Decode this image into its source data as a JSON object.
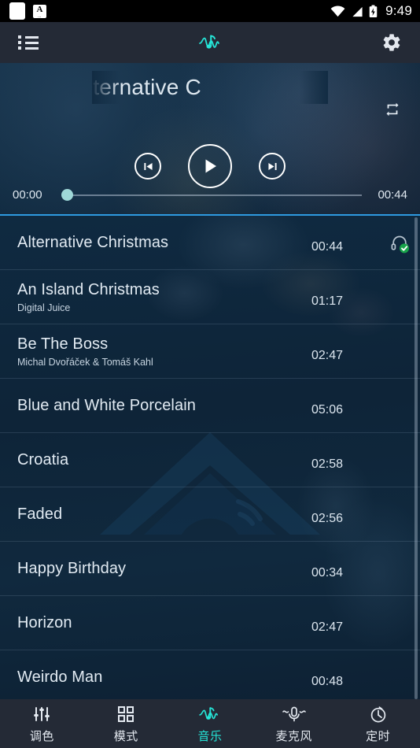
{
  "statusbar": {
    "left_icons": [
      "app-square-icon",
      "letter-a-badge-icon"
    ],
    "badge_letter": "A",
    "badge_sub": "...",
    "right_icons": [
      "wifi-icon",
      "cellular-signal-icon",
      "battery-charging-icon"
    ],
    "time": "9:49"
  },
  "toolbar": {
    "menu_icon": "list-menu-icon",
    "brand_icon": "music-wave-icon",
    "settings_icon": "gear-icon"
  },
  "player": {
    "track_title": "Alternative C",
    "repeat_icon": "repeat-icon",
    "prev_icon": "skip-previous-icon",
    "play_icon": "play-icon",
    "next_icon": "skip-next-icon",
    "elapsed": "00:00",
    "duration": "00:44",
    "progress_percent": 0,
    "accent_color": "#2e9ae0",
    "seek_dot_color": "#9fd8d8"
  },
  "list": {
    "now_playing_icon": "headphone-check-icon",
    "songs": [
      {
        "title": "Alternative Christmas",
        "artist": "",
        "duration": "00:44",
        "now_playing": true
      },
      {
        "title": "An Island Christmas",
        "artist": "Digital Juice",
        "duration": "01:17",
        "now_playing": false
      },
      {
        "title": "Be The Boss",
        "artist": "Michal Dvořáček & Tomáš Kahl",
        "duration": "02:47",
        "now_playing": false
      },
      {
        "title": "Blue and White Porcelain",
        "artist": "",
        "duration": "05:06",
        "now_playing": false
      },
      {
        "title": "Croatia",
        "artist": "",
        "duration": "02:58",
        "now_playing": false
      },
      {
        "title": "Faded",
        "artist": "",
        "duration": "02:56",
        "now_playing": false
      },
      {
        "title": "Happy Birthday",
        "artist": "",
        "duration": "00:34",
        "now_playing": false
      },
      {
        "title": "Horizon",
        "artist": "",
        "duration": "02:47",
        "now_playing": false
      },
      {
        "title": "Weirdo Man",
        "artist": "",
        "duration": "00:48",
        "now_playing": false
      }
    ]
  },
  "bottomnav": {
    "active_color": "#25e6d8",
    "items": [
      {
        "label": "调色",
        "icon": "sliders-icon",
        "active": false
      },
      {
        "label": "模式",
        "icon": "grid-icon",
        "active": false
      },
      {
        "label": "音乐",
        "icon": "music-wave-icon",
        "active": true
      },
      {
        "label": "麦克风",
        "icon": "microphone-icon",
        "active": false
      },
      {
        "label": "定时",
        "icon": "timer-icon",
        "active": false
      }
    ]
  }
}
